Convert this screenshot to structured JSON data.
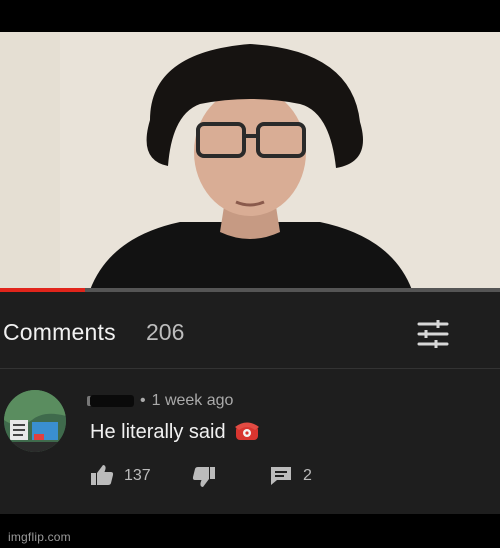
{
  "video": {
    "progress_fraction": 0.17
  },
  "comments_header": {
    "title": "Comments",
    "count": "206",
    "sort_icon": "sort-icon"
  },
  "comment": {
    "time": "1 week ago",
    "text": "He literally said",
    "emoji": "telephone-receiver",
    "like_count": "137",
    "reply_count": "2"
  },
  "watermark": {
    "text": "imgflip.com"
  },
  "colors": {
    "progress": "#e1251b",
    "panel_bg": "#1e1e1e",
    "text_primary": "#f1f1f1",
    "text_secondary": "#aaaaaa"
  }
}
